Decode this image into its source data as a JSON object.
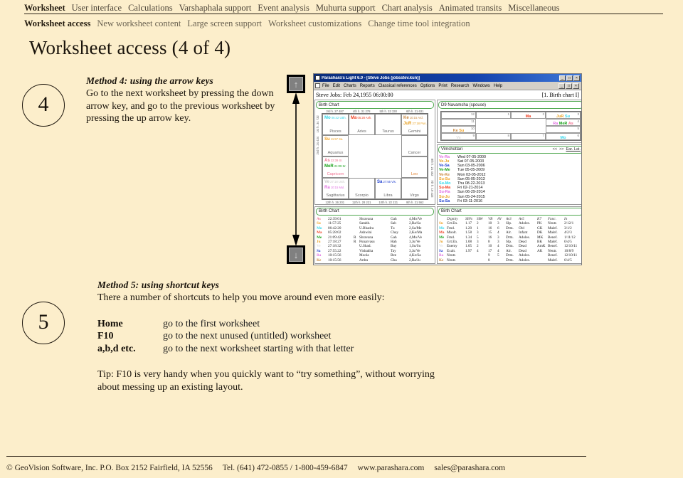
{
  "nav": {
    "primary": [
      {
        "label": "Worksheet",
        "active": true
      },
      {
        "label": "User interface",
        "active": false
      },
      {
        "label": "Calculations",
        "active": false
      },
      {
        "label": "Varshaphala support",
        "active": false
      },
      {
        "label": "Event analysis",
        "active": false
      },
      {
        "label": "Muhurta support",
        "active": false
      },
      {
        "label": "Chart analysis",
        "active": false
      },
      {
        "label": "Animated transits",
        "active": false
      },
      {
        "label": "Miscellaneous",
        "active": false
      }
    ],
    "secondary": [
      {
        "label": "Worksheet access",
        "active": true
      },
      {
        "label": "New worksheet content",
        "active": false
      },
      {
        "label": "Large screen support",
        "active": false
      },
      {
        "label": "Worksheet customizations",
        "active": false
      },
      {
        "label": "Change time tool integration",
        "active": false
      }
    ]
  },
  "page": {
    "title": "Worksheet access (4 of 4)"
  },
  "method4": {
    "number": "4",
    "heading": "Method 4: using the arrow keys",
    "body": "Go to the next worksheet by pressing the down arrow key, and go to the previous worksheet by pressing the up arrow key."
  },
  "method5": {
    "number": "5",
    "heading": "Method 5: using shortcut keys",
    "body": "There a number of shortcuts to help you move around even more easily:",
    "shortcuts": [
      {
        "key": "Home",
        "desc": "go to the first worksheet"
      },
      {
        "key": "F10",
        "desc": "go to the next unused (untitled) worksheet"
      },
      {
        "key": "a,b,d etc.",
        "desc": "go to the next worksheet starting with that letter"
      }
    ],
    "tip": "Tip: F10 is very handy when you quickly want to “try something”, without worrying about messing up an existing layout."
  },
  "arrow_keys": {
    "up_glyph": "↑",
    "down_glyph": "↓"
  },
  "app": {
    "title": "Parashara's Light 6.0 - [Steve Jobs (jobsstev.kun)]",
    "window_buttons": [
      "_",
      "□",
      "×"
    ],
    "mdi_buttons": [
      "_",
      "□",
      "×"
    ],
    "menu": [
      "File",
      "Edit",
      "Charts",
      "Reports",
      "Classical references",
      "Options",
      "Print",
      "Research",
      "Windows",
      "Help"
    ],
    "databar": {
      "left": "Steve Jobs:   Feb 24,1955   06:00:00",
      "right": "[1. Birth chart I]"
    },
    "rasi_panel": {
      "title": "Birth Chart",
      "cusps_top": [
        "3rd h.  27  487",
        "4th h.  31  278",
        "5th h.  33  330",
        "6th h.  21  631"
      ],
      "cusps_bottom": [
        "12th h.  26  201",
        "11th h.  28  221",
        "10th h.  22  221",
        "9th h.  21  562"
      ],
      "cusps_left": [
        "1st h.  34  732",
        "2nd h.  24  434"
      ],
      "cusps_right": [
        "8th h.  21  462",
        "7th h.  19  433"
      ],
      "cells": [
        {
          "sign": "Pisces",
          "planets": [
            {
              "abbr": "Mo",
              "deg": "06:42 UBh.",
              "color": "#2fd6ea"
            }
          ]
        },
        {
          "sign": "Aries",
          "planets": [
            {
              "abbr": "Ma",
              "deg": "05:28 Ash.",
              "color": "#f03c1e"
            }
          ]
        },
        {
          "sign": "Taurus",
          "planets": []
        },
        {
          "sign": "Gemini",
          "planets": [
            {
              "abbr": "Ke",
              "deg": "10:15 Ard.",
              "color": "#c8863c"
            },
            {
              "abbr": "JuR",
              "deg": "27:18 Pun.",
              "color": "#e8a020"
            }
          ]
        },
        {
          "sign": "Aquarius",
          "planets": [
            {
              "abbr": "Su",
              "deg": "11:57 Sa.",
              "color": "#f0a020"
            }
          ]
        },
        {
          "sign": "",
          "planets": []
        },
        {
          "sign": "",
          "planets": []
        },
        {
          "sign": "Cancer",
          "planets": []
        },
        {
          "sign": "Capricorn",
          "planets": [
            {
              "abbr": "As",
              "deg": "22:39 Sr.",
              "color": "#f07090"
            },
            {
              "abbr": "MeR",
              "deg": "21:09 Sr.",
              "color": "#18a018"
            }
          ]
        },
        {
          "sign": "",
          "planets": []
        },
        {
          "sign": "",
          "planets": []
        },
        {
          "sign": "Leo",
          "planets": []
        },
        {
          "sign": "Sagittarius",
          "planets": [
            {
              "abbr": "Ve",
              "deg": "27:18 USh.",
              "color": "#c8c8c8"
            },
            {
              "abbr": "Ra",
              "deg": "10:15 Mul.",
              "color": "#e070e0"
            }
          ]
        },
        {
          "sign": "Scorpio",
          "planets": []
        },
        {
          "sign": "Libra",
          "planets": [
            {
              "abbr": "Sa",
              "deg": "27:55 Vis.",
              "color": "#2040d0"
            }
          ]
        },
        {
          "sign": "Virgo",
          "planets": []
        }
      ]
    },
    "navamsha_panel": {
      "title": "D9 Navamsha  (spouse)",
      "cells": [
        {
          "house": "12",
          "planets": []
        },
        {
          "house": "1",
          "planets": []
        },
        {
          "house": "2",
          "planets": [
            {
              "abbr": "Ma",
              "color": "#f03c1e"
            }
          ]
        },
        {
          "house": "3",
          "planets": [
            {
              "abbr": "JuR",
              "color": "#e8a020"
            },
            {
              "abbr": "Su",
              "color": "#2fd6ea"
            }
          ]
        },
        {
          "house": "11",
          "planets": []
        },
        {
          "house": "",
          "planets": []
        },
        {
          "house": "",
          "planets": []
        },
        {
          "house": "4",
          "planets": [
            {
              "abbr": "Ra",
              "color": "#e070e0"
            },
            {
              "abbr": "MeR",
              "color": "#18a018"
            },
            {
              "abbr": "As",
              "color": "#f07090"
            }
          ]
        },
        {
          "house": "10",
          "planets": [
            {
              "abbr": "Ke",
              "color": "#c8863c"
            },
            {
              "abbr": "Su",
              "color": "#f0a020"
            }
          ]
        },
        {
          "house": "",
          "planets": []
        },
        {
          "house": "",
          "planets": []
        },
        {
          "house": "5",
          "planets": []
        },
        {
          "house": "9",
          "planets": [
            {
              "abbr": "Ve",
              "color": "#dcdcdc"
            }
          ]
        },
        {
          "house": "8",
          "planets": []
        },
        {
          "house": "7",
          "planets": []
        },
        {
          "house": "6",
          "planets": [
            {
              "abbr": "Mo",
              "color": "#2fd6ea"
            }
          ]
        }
      ]
    },
    "dasha_panel": {
      "title": "Vimshottari",
      "nav_prev": "<<",
      "nav_next": ">>",
      "nav_list": "Ear. Lat.",
      "rows": [
        {
          "lord": "Ve-Ra",
          "color": "#e070e0",
          "date": "Wed 07-05-2000"
        },
        {
          "lord": "Ve-Ju",
          "color": "#e8a020",
          "date": "Sat  07-05-2003"
        },
        {
          "lord": "Ve-Sa",
          "color": "#2040d0",
          "date": "Sun 03-05-2006"
        },
        {
          "lord": "Ve-Me",
          "color": "#18a018",
          "date": "Tue 05-05-2009"
        },
        {
          "lord": "Ve-Ke",
          "color": "#c8863c",
          "date": "Mon 03-05-2012"
        },
        {
          "lord": "Su-Su",
          "color": "#f0a020",
          "date": "Sun 05-05-2013"
        },
        {
          "lord": "Su-Mo",
          "color": "#2fd6ea",
          "date": "Thu 08-22-2013"
        },
        {
          "lord": "Su-Ma",
          "color": "#f03c1e",
          "date": "Fri   02-21-2014"
        },
        {
          "lord": "Su-Ra",
          "color": "#e070e0",
          "date": "Sun 06-29-2014"
        },
        {
          "lord": "Su-Ju",
          "color": "#e8a020",
          "date": "Sun 05-24-2015"
        },
        {
          "lord": "Su-Sa",
          "color": "#2040d0",
          "date": "Fri   03-11-2016"
        }
      ]
    },
    "table_left": {
      "title": "Birth Chart",
      "rows": [
        {
          "pl": "As",
          "color": "#f07090",
          "deg": "22:39:01",
          "r": "",
          "nak": "Shravana",
          "pada": "Gah",
          "sub": "4,Mo/Ve"
        },
        {
          "pl": "Su",
          "color": "#f0a020",
          "deg": "11:57:25",
          "r": "",
          "nak": "Satabh.",
          "pada": "Sah",
          "sub": "2,Ra/Sa"
        },
        {
          "pl": "Mo",
          "color": "#2fd6ea",
          "deg": "06:42:20",
          "r": "",
          "nak": "U.Bhadra",
          "pada": "Tu",
          "sub": "2,Sa/Me"
        },
        {
          "pl": "Ma",
          "color": "#f03c1e",
          "deg": "05:28:02",
          "r": "",
          "nak": "Ashwini",
          "pada": "Chay",
          "sub": "2,Ke/Ma"
        },
        {
          "pl": "Me",
          "color": "#18a018",
          "deg": "21:09:42",
          "r": "R",
          "nak": "Shravana",
          "pada": "Gah",
          "sub": "4,Mo/Ve"
        },
        {
          "pl": "Ju",
          "color": "#e8a020",
          "deg": "27:18:27",
          "r": "R",
          "nak": "Punarvasu",
          "pada": "Hah",
          "sub": "3,Ju/Ve"
        },
        {
          "pl": "Ve",
          "color": "#dcdcdc",
          "deg": "27:18:32",
          "r": "",
          "nak": "U.Shad.",
          "pada": "Bay",
          "sub": "1,Su/Su"
        },
        {
          "pl": "Sa",
          "color": "#2040d0",
          "deg": "27:55:22",
          "r": "",
          "nak": "Vishakha",
          "pada": "Tay",
          "sub": "3,Ju/Ve"
        },
        {
          "pl": "Ra",
          "color": "#e070e0",
          "deg": "10:15:56",
          "r": "",
          "nak": "Moola",
          "pada": "Bee",
          "sub": "4,Ke/Sa"
        },
        {
          "pl": "Ke",
          "color": "#c8863c",
          "deg": "10:15:56",
          "r": "",
          "nak": "Ardra",
          "pada": "Gha",
          "sub": "2,Ra/Ju"
        }
      ]
    },
    "table_right": {
      "title": "Birth Chart",
      "headers": [
        "Dignity",
        "SB%",
        "SB#",
        "VB",
        "AV",
        "Av3",
        "Av5",
        "K7",
        "Func.",
        "In"
      ],
      "rows": [
        {
          "pl": "Su",
          "color": "#f0a020",
          "cells": [
            "Grt.En.",
            "1.17",
            "2",
            "10",
            "3",
            "Slp.",
            "Adoles.",
            "PK",
            "Neutr.",
            "2/12/1"
          ]
        },
        {
          "pl": "Mo",
          "color": "#2fd6ea",
          "cells": [
            "Frnd.",
            "1.20",
            "1",
            "16",
            "6",
            "Drm.",
            "Old",
            "GK",
            "Malef.",
            "3/1/2"
          ]
        },
        {
          "pl": "Ma",
          "color": "#f03c1e",
          "cells": [
            "Moolt.",
            "1.58",
            "3",
            "15",
            "4",
            "Alr.",
            "Infant",
            "DK",
            "Malef.",
            "4/2/3"
          ]
        },
        {
          "pl": "Me",
          "color": "#18a018",
          "cells": [
            "Frnd.",
            "1.34",
            "5",
            "16",
            "3",
            "Drm.",
            "Adoles.",
            "MK",
            "Benef.",
            "1/11/12"
          ]
        },
        {
          "pl": "Ju",
          "color": "#e8a020",
          "cells": [
            "Grt.En.",
            "1.08",
            "3",
            "8",
            "3",
            "Slp.",
            "Dead",
            "BK",
            "Malef.",
            "6/4/5"
          ]
        },
        {
          "pl": "Ve",
          "color": "#dcdcdc",
          "cells": [
            "Enemy",
            "1.05",
            "2",
            "10",
            "4",
            "Drm.",
            "Dead",
            "AmK",
            "Benef.",
            "12/10/11"
          ]
        },
        {
          "pl": "Sa",
          "color": "#2040d0",
          "cells": [
            "Exalt.",
            "1.97",
            "4",
            "17",
            "4",
            "Alr.",
            "Dead",
            "AK",
            "Neutr.",
            "10/8/9"
          ]
        },
        {
          "pl": "Ra",
          "color": "#e070e0",
          "cells": [
            "Neutr.",
            "",
            "",
            "9",
            "5",
            "Drm.",
            "Adoles.",
            "",
            "Benef.",
            "12/10/11"
          ]
        },
        {
          "pl": "Ke",
          "color": "#c8863c",
          "cells": [
            "Neutr.",
            "",
            "",
            "8",
            "",
            "Drm.",
            "Adoles.",
            "",
            "Malef.",
            "6/4/5"
          ]
        }
      ]
    }
  },
  "footer": {
    "company": "© GeoVision Software, Inc. P.O. Box 2152 Fairfield, IA 52556",
    "tel": "Tel. (641) 472-0855 / 1-800-459-6847",
    "web": "www.parashara.com",
    "email": "sales@parashara.com"
  },
  "colors": {
    "page_bg": "#fceecb",
    "rule": "#2a2115",
    "title_bar": "#0a2c7a"
  }
}
